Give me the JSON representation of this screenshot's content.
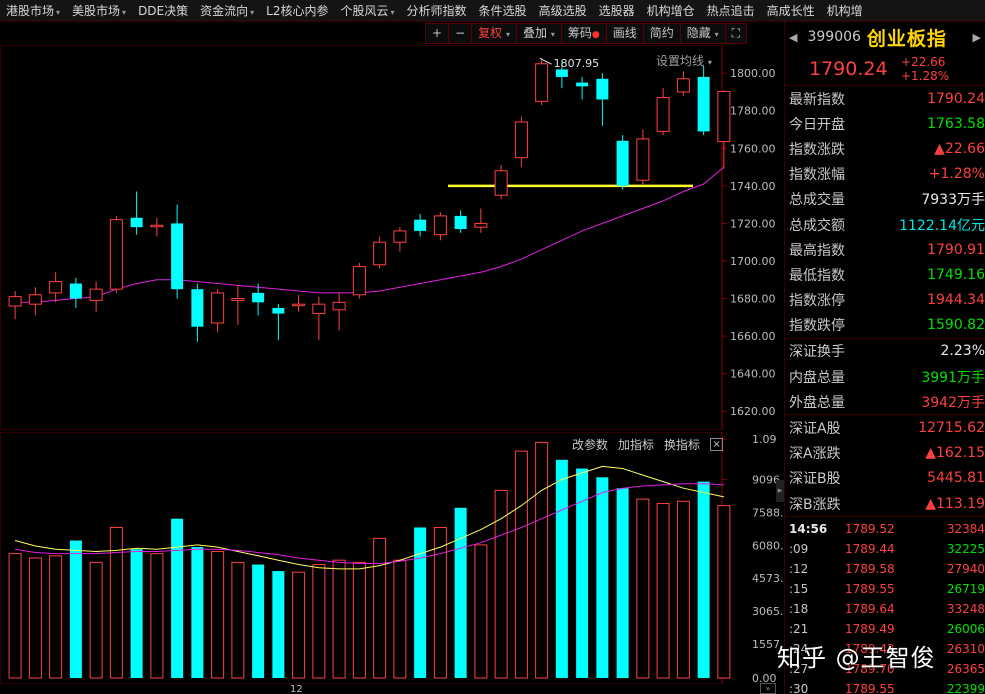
{
  "menu": [
    {
      "label": "港股市场",
      "dropdown": true
    },
    {
      "label": "美股市场",
      "dropdown": true
    },
    {
      "label": "DDE决策",
      "dropdown": false
    },
    {
      "label": "资金流向",
      "dropdown": true
    },
    {
      "label": "L2核心内参",
      "dropdown": false
    },
    {
      "label": "个股风云",
      "dropdown": true
    },
    {
      "label": "分析师指数",
      "dropdown": false
    },
    {
      "label": "条件选股",
      "dropdown": false
    },
    {
      "label": "高级选股",
      "dropdown": false
    },
    {
      "label": "选股器",
      "dropdown": false
    },
    {
      "label": "机构增仓",
      "dropdown": false
    },
    {
      "label": "热点追击",
      "dropdown": false
    },
    {
      "label": "高成长性",
      "dropdown": false
    },
    {
      "label": "机构增",
      "dropdown": false
    }
  ],
  "toolbar": {
    "zoom_in": "+",
    "zoom_out": "−",
    "fuquan": "复权",
    "overlay": "叠加",
    "chips": "筹码",
    "draw": "画线",
    "simple": "简约",
    "hide": "隐藏",
    "fullscreen": "⛶"
  },
  "ma_setting": "设置均线",
  "high_label": "1807.95",
  "volume_tools": {
    "params": "改参数",
    "add": "加指标",
    "switch": "换指标",
    "close": "×"
  },
  "date_label": "12",
  "panel": {
    "code": "399006",
    "name": "创业板指",
    "price": "1790.24",
    "change": "+22.66",
    "change_pct": "+1.28%",
    "stats1": [
      {
        "label": "最新指数",
        "value": "1790.24",
        "color": "red"
      },
      {
        "label": "今日开盘",
        "value": "1763.58",
        "color": "green"
      },
      {
        "label": "指数涨跌",
        "value": "▲22.66",
        "color": "red"
      },
      {
        "label": "指数涨幅",
        "value": "+1.28%",
        "color": "red"
      },
      {
        "label": "总成交量",
        "value": "7933万手",
        "color": "white"
      },
      {
        "label": "总成交额",
        "value": "1122.14亿元",
        "color": "cyan"
      },
      {
        "label": "最高指数",
        "value": "1790.91",
        "color": "red"
      },
      {
        "label": "最低指数",
        "value": "1749.16",
        "color": "green"
      },
      {
        "label": "指数涨停",
        "value": "1944.34",
        "color": "red"
      },
      {
        "label": "指数跌停",
        "value": "1590.82",
        "color": "green"
      }
    ],
    "stats2": [
      {
        "label": "深证换手",
        "value": "2.23%",
        "color": "white"
      },
      {
        "label": "内盘总量",
        "value": "3991万手",
        "color": "green"
      },
      {
        "label": "外盘总量",
        "value": "3942万手",
        "color": "red"
      }
    ],
    "stats3": [
      {
        "label": "深证A股",
        "value": "12715.62",
        "color": "red"
      },
      {
        "label": "深A涨跌",
        "value": "▲162.15",
        "color": "red"
      },
      {
        "label": "深证B股",
        "value": "5445.81",
        "color": "red"
      },
      {
        "label": "深B涨跌",
        "value": "▲113.19",
        "color": "red"
      }
    ],
    "ticks": [
      {
        "time": "14:56",
        "price": "1789.52",
        "volume": "32384",
        "color": "red"
      },
      {
        "time": ":09",
        "price": "1789.44",
        "volume": "32225",
        "color": "green"
      },
      {
        "time": ":12",
        "price": "1789.58",
        "volume": "27940",
        "color": "red"
      },
      {
        "time": ":15",
        "price": "1789.55",
        "volume": "26719",
        "color": "green"
      },
      {
        "time": ":18",
        "price": "1789.64",
        "volume": "33248",
        "color": "red"
      },
      {
        "time": ":21",
        "price": "1789.49",
        "volume": "26006",
        "color": "green"
      },
      {
        "time": ":24",
        "price": "1789.42",
        "volume": "26310",
        "color": "red"
      },
      {
        "time": ":27",
        "price": "1789.70",
        "volume": "26365",
        "color": "red"
      },
      {
        "time": ":30",
        "price": "1789.55",
        "volume": "22399",
        "color": "green"
      }
    ]
  },
  "watermark": "知乎 @王智俊",
  "colors": {
    "up": "#ff4040",
    "down": "#00ffff",
    "ma_price": "#e020e0",
    "ma_vol_fast": "#ffff60",
    "support": "#ffff30"
  },
  "chart_data": [
    {
      "type": "candlestick",
      "ylabel_ticks": [
        "1800.00",
        "1780.00",
        "1760.00",
        "1740.00",
        "1720.00",
        "1700.00",
        "1680.00",
        "1660.00",
        "1640.00",
        "1620.00"
      ],
      "ylim": [
        1610,
        1815
      ],
      "high_marker": 1807.95,
      "support_line": 1740,
      "candles": [
        {
          "o": 1676,
          "c": 1681,
          "h": 1684,
          "l": 1669
        },
        {
          "o": 1677,
          "c": 1682,
          "h": 1686,
          "l": 1671
        },
        {
          "o": 1683,
          "c": 1689,
          "h": 1694,
          "l": 1678
        },
        {
          "o": 1688,
          "c": 1680,
          "h": 1691,
          "l": 1675
        },
        {
          "o": 1679,
          "c": 1685,
          "h": 1689,
          "l": 1673
        },
        {
          "o": 1685,
          "c": 1722,
          "h": 1724,
          "l": 1683
        },
        {
          "o": 1723,
          "c": 1718,
          "h": 1737,
          "l": 1714
        },
        {
          "o": 1719,
          "c": 1719,
          "h": 1723,
          "l": 1713
        },
        {
          "o": 1720,
          "c": 1685,
          "h": 1730,
          "l": 1680
        },
        {
          "o": 1685,
          "c": 1665,
          "h": 1688,
          "l": 1657
        },
        {
          "o": 1667,
          "c": 1683,
          "h": 1685,
          "l": 1662
        },
        {
          "o": 1679,
          "c": 1680,
          "h": 1687,
          "l": 1666
        },
        {
          "o": 1683,
          "c": 1678,
          "h": 1688,
          "l": 1671
        },
        {
          "o": 1675,
          "c": 1672,
          "h": 1677,
          "l": 1658
        },
        {
          "o": 1677,
          "c": 1677,
          "h": 1682,
          "l": 1673
        },
        {
          "o": 1672,
          "c": 1677,
          "h": 1681,
          "l": 1658
        },
        {
          "o": 1674,
          "c": 1678,
          "h": 1683,
          "l": 1663
        },
        {
          "o": 1682,
          "c": 1697,
          "h": 1699,
          "l": 1680
        },
        {
          "o": 1698,
          "c": 1710,
          "h": 1713,
          "l": 1696
        },
        {
          "o": 1710,
          "c": 1716,
          "h": 1718,
          "l": 1705
        },
        {
          "o": 1722,
          "c": 1716,
          "h": 1725,
          "l": 1713
        },
        {
          "o": 1714,
          "c": 1724,
          "h": 1726,
          "l": 1711
        },
        {
          "o": 1724,
          "c": 1717,
          "h": 1727,
          "l": 1715
        },
        {
          "o": 1718,
          "c": 1720,
          "h": 1728,
          "l": 1715
        },
        {
          "o": 1735,
          "c": 1748,
          "h": 1751,
          "l": 1733
        },
        {
          "o": 1755,
          "c": 1774,
          "h": 1777,
          "l": 1750
        },
        {
          "o": 1785,
          "c": 1805,
          "h": 1807.95,
          "l": 1783
        },
        {
          "o": 1802,
          "c": 1798,
          "h": 1806,
          "l": 1792
        },
        {
          "o": 1795,
          "c": 1793,
          "h": 1798,
          "l": 1786
        },
        {
          "o": 1797,
          "c": 1786,
          "h": 1800,
          "l": 1772
        },
        {
          "o": 1764,
          "c": 1740,
          "h": 1767,
          "l": 1738
        },
        {
          "o": 1743,
          "c": 1765,
          "h": 1770,
          "l": 1741
        },
        {
          "o": 1769,
          "c": 1787,
          "h": 1792,
          "l": 1767
        },
        {
          "o": 1790,
          "c": 1797,
          "h": 1801,
          "l": 1788
        },
        {
          "o": 1798,
          "c": 1769,
          "h": 1804,
          "l": 1767
        },
        {
          "o": 1763.58,
          "c": 1790.24,
          "h": 1790.91,
          "l": 1749.16
        }
      ],
      "ma": [
        1678,
        1678,
        1679,
        1680,
        1681,
        1685,
        1688,
        1690,
        1690,
        1689,
        1688,
        1687,
        1686,
        1685,
        1684,
        1683,
        1683,
        1683,
        1684,
        1686,
        1688,
        1690,
        1692,
        1694,
        1697,
        1701,
        1706,
        1711,
        1716,
        1720,
        1724,
        1728,
        1732,
        1737,
        1741,
        1750
      ]
    },
    {
      "type": "bar",
      "ylabel_ticks": [
        "1.09",
        "9096.00",
        "7588.00",
        "6080.00",
        "4573.00",
        "3065.00",
        "1557.00",
        "0.00"
      ],
      "ylim": [
        0,
        11000
      ],
      "volumes": [
        5700,
        5500,
        5600,
        6300,
        5300,
        6900,
        5900,
        5700,
        7300,
        6000,
        5800,
        5300,
        5200,
        4900,
        4850,
        5200,
        5400,
        5300,
        6400,
        5400,
        6900,
        6900,
        7800,
        6100,
        8600,
        10400,
        10800,
        10000,
        9600,
        9200,
        8700,
        8200,
        8000,
        8100,
        9000,
        7900
      ],
      "ma_fast": [
        6300,
        6050,
        5900,
        5850,
        5800,
        5850,
        5950,
        5900,
        6000,
        6100,
        6000,
        5800,
        5600,
        5400,
        5200,
        5050,
        5000,
        5000,
        5150,
        5400,
        5700,
        6000,
        6400,
        6800,
        7300,
        7900,
        8600,
        9100,
        9400,
        9700,
        9600,
        9300,
        9000,
        8700,
        8500,
        8300
      ],
      "ma_slow": [
        5900,
        5750,
        5700,
        5700,
        5700,
        5750,
        5800,
        5800,
        5850,
        5900,
        5900,
        5850,
        5750,
        5650,
        5500,
        5400,
        5300,
        5250,
        5250,
        5350,
        5500,
        5700,
        5950,
        6200,
        6550,
        6900,
        7300,
        7700,
        8100,
        8500,
        8700,
        8800,
        8850,
        8900,
        8900,
        8850
      ]
    }
  ]
}
